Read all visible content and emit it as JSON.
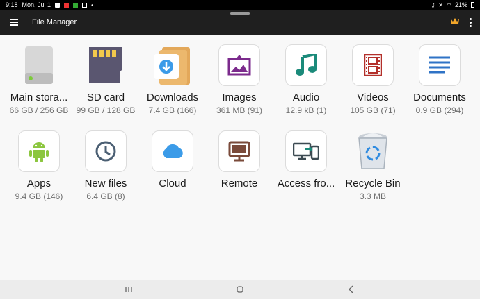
{
  "status": {
    "time": "9:18",
    "date": "Mon, Jul 1",
    "battery": "21%"
  },
  "appbar": {
    "title": "File Manager +"
  },
  "items": [
    {
      "label": "Main stora...",
      "sub": "66 GB / 256 GB",
      "icon": "hard-drive-icon"
    },
    {
      "label": "SD card",
      "sub": "99 GB / 128 GB",
      "icon": "sd-card-icon"
    },
    {
      "label": "Downloads",
      "sub": "7.4 GB (166)",
      "icon": "downloads-folder-icon"
    },
    {
      "label": "Images",
      "sub": "361 MB (91)",
      "icon": "image-icon"
    },
    {
      "label": "Audio",
      "sub": "12.9 kB (1)",
      "icon": "music-note-icon"
    },
    {
      "label": "Videos",
      "sub": "105 GB (71)",
      "icon": "film-icon"
    },
    {
      "label": "Documents",
      "sub": "0.9 GB (294)",
      "icon": "document-icon"
    },
    {
      "label": "Apps",
      "sub": "9.4 GB (146)",
      "icon": "android-icon"
    },
    {
      "label": "New files",
      "sub": "6.4 GB (8)",
      "icon": "clock-icon"
    },
    {
      "label": "Cloud",
      "sub": "",
      "icon": "cloud-icon"
    },
    {
      "label": "Remote",
      "sub": "",
      "icon": "monitor-icon"
    },
    {
      "label": "Access fro...",
      "sub": "",
      "icon": "devices-icon"
    },
    {
      "label": "Recycle Bin",
      "sub": "3.3 MB",
      "icon": "recycle-bin-icon"
    }
  ],
  "colors": {
    "appbar": "#1f1f1f",
    "crown": "#f2a62a",
    "images": "#7b2a8c",
    "audio": "#1b8a7a",
    "videos": "#b3302b",
    "documents": "#2f73c6",
    "apps": "#8cc63f",
    "cloud": "#3b9be8",
    "remote": "#7a4a3a"
  }
}
